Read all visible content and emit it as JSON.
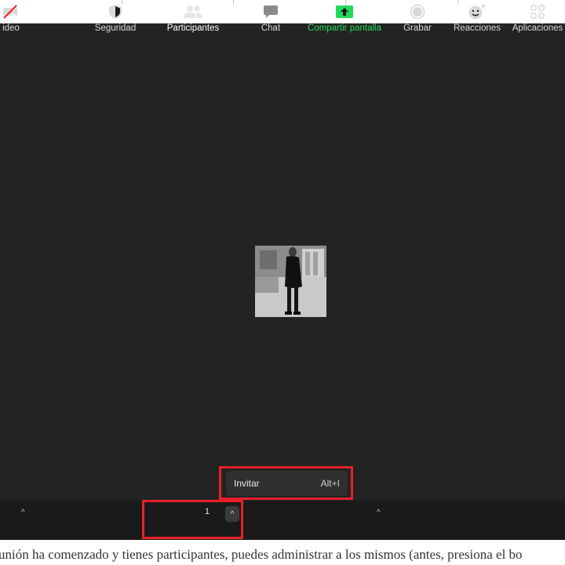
{
  "colors": {
    "stage_bg": "#232323",
    "toolbar_bg": "#1a1a1a",
    "highlight": "#e8202a",
    "share_green": "#23d959",
    "text_light": "#d9d9d9"
  },
  "popup_menu": {
    "item_label": "Invitar",
    "shortcut": "Alt+I"
  },
  "toolbar": {
    "video_label": "ideo",
    "security_label": "Seguridad",
    "participants_label": "Participantes",
    "participants_count": "1",
    "chat_label": "Chat",
    "share_label": "Compartir pantalla",
    "record_label": "Grabar",
    "reactions_label": "Reacciones",
    "apps_label": "Aplicaciones",
    "caret": "^"
  },
  "article": {
    "text": "unión ha comenzado y tienes participantes, puedes administrar a los mismos (antes, presiona el bo"
  },
  "icons": [
    "video-off-icon",
    "shield-icon",
    "participants-icon",
    "chat-icon",
    "share-screen-icon",
    "record-icon",
    "reactions-icon",
    "apps-icon"
  ]
}
